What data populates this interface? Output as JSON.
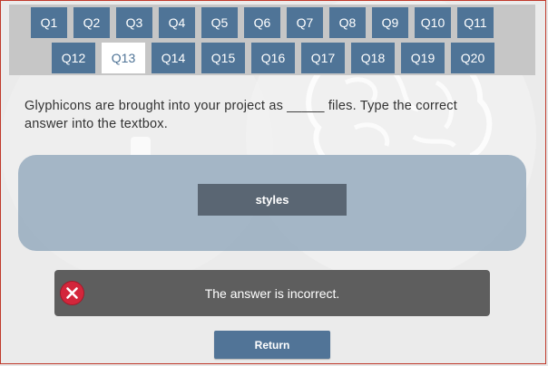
{
  "questions": {
    "row1": [
      "Q1",
      "Q2",
      "Q3",
      "Q4",
      "Q5",
      "Q6",
      "Q7",
      "Q8",
      "Q9",
      "Q10",
      "Q11"
    ],
    "row2": [
      "Q12",
      "Q13",
      "Q14",
      "Q15",
      "Q16",
      "Q17",
      "Q18",
      "Q19",
      "Q20"
    ],
    "active": "Q13"
  },
  "question": {
    "text": "Glyphicons are brought into your project as _____ files. Type the correct answer into the textbox."
  },
  "answer": {
    "value": "styles"
  },
  "feedback": {
    "text": "The answer is incorrect.",
    "icon": "error-x-icon",
    "icon_color": "#d3263b"
  },
  "actions": {
    "return_label": "Return"
  },
  "colors": {
    "button": "#4f7497",
    "feedback_bg": "#5e5e5e",
    "answer_area": "#9fb2c3"
  }
}
